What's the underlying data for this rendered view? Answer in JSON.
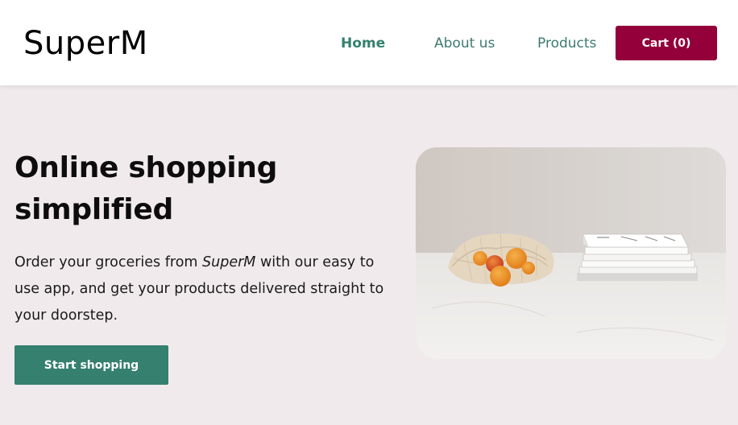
{
  "navbar": {
    "logo": "SuperM",
    "links": [
      {
        "label": "Home",
        "active": true
      },
      {
        "label": "About us",
        "active": false
      },
      {
        "label": "Products",
        "active": false
      }
    ],
    "cart_label": "Cart (0)"
  },
  "hero": {
    "title": "Online shopping simplified",
    "text_before": "Order your groceries from ",
    "text_brand": "SuperM",
    "text_after": " with our easy to use app, and get your products delivered straight to your doorstep.",
    "button_label": "Start shopping",
    "image": "groceries-bag-with-oranges-and-books-photo"
  },
  "colors": {
    "background": "#f1eaed",
    "accent": "#35806f",
    "cart": "#93003a"
  }
}
